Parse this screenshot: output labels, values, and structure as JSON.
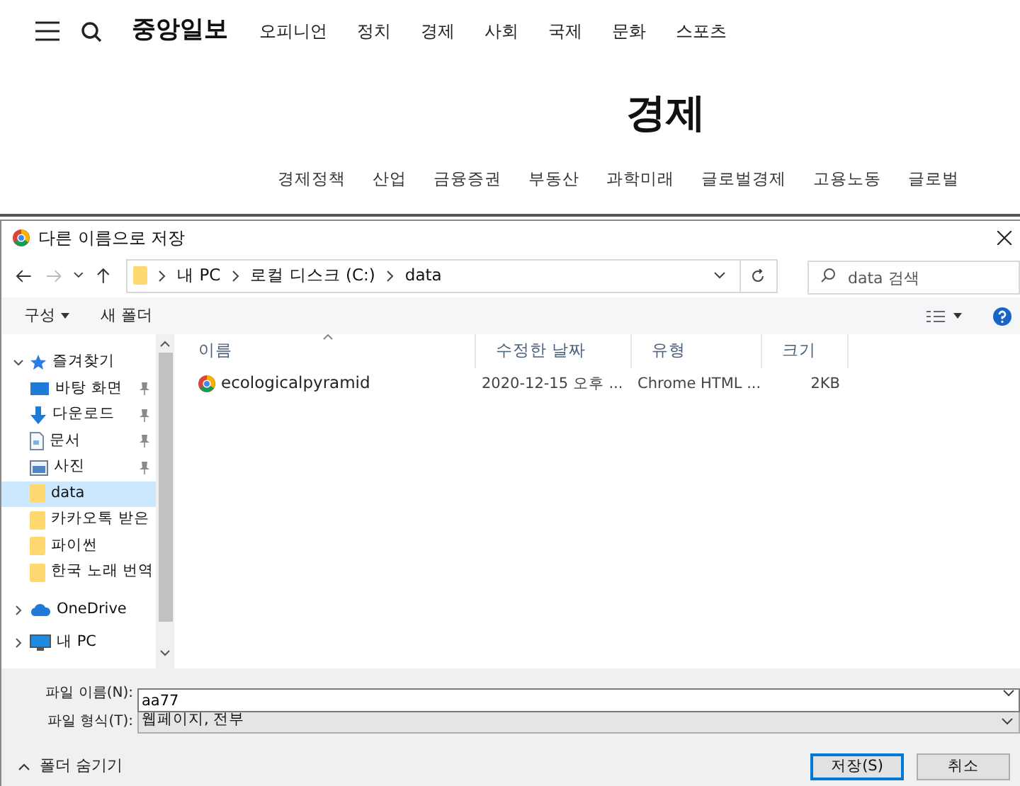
{
  "site": {
    "logo": "중앙일보",
    "nav": [
      "오피니언",
      "정치",
      "경제",
      "사회",
      "국제",
      "문화",
      "스포츠"
    ],
    "section_title": "경제",
    "subnav": [
      "경제정책",
      "산업",
      "금융증권",
      "부동산",
      "과학미래",
      "글로벌경제",
      "고용노동",
      "글로벌"
    ]
  },
  "dialog": {
    "title": "다른 이름으로 저장",
    "path": [
      "내 PC",
      "로컬 디스크 (C:)",
      "data"
    ],
    "search": {
      "placeholder": "data 검색"
    },
    "toolbar": {
      "organize": "구성",
      "new_folder": "새 폴더"
    },
    "sidebar": [
      {
        "label": "즐겨찾기",
        "kind": "star",
        "expanded": true,
        "selected": false,
        "children": [
          {
            "label": "바탕 화면",
            "kind": "desktop",
            "pinned": true,
            "selected": false
          },
          {
            "label": "다운로드",
            "kind": "download",
            "pinned": true,
            "selected": false
          },
          {
            "label": "문서",
            "kind": "document",
            "pinned": true,
            "selected": false
          },
          {
            "label": "사진",
            "kind": "photo",
            "pinned": true,
            "selected": false
          },
          {
            "label": "data",
            "kind": "folder",
            "pinned": false,
            "selected": true
          },
          {
            "label": "카카오톡 받은",
            "kind": "folder",
            "pinned": false,
            "selected": false
          },
          {
            "label": "파이썬",
            "kind": "folder",
            "pinned": false,
            "selected": false
          },
          {
            "label": "한국 노래 번역",
            "kind": "folder",
            "pinned": false,
            "selected": false
          }
        ]
      },
      {
        "label": "OneDrive",
        "kind": "cloud",
        "expanded": false,
        "selected": false
      },
      {
        "label": "내 PC",
        "kind": "pc",
        "expanded": false,
        "selected": false
      }
    ],
    "columns": [
      "이름",
      "수정한 날짜",
      "유형",
      "크기"
    ],
    "rows": [
      {
        "name": "ecologicalpyramid",
        "modified": "2020-12-15 오후 ...",
        "type": "Chrome HTML ...",
        "size": "2KB"
      }
    ],
    "file_name_label": "파일 이름(N):",
    "file_name": "aa77",
    "file_type_label": "파일 형식(T):",
    "file_type": "웹페이지, 전부",
    "hide_folders": "폴더 숨기기",
    "save": "저장(S)",
    "cancel": "취소"
  }
}
